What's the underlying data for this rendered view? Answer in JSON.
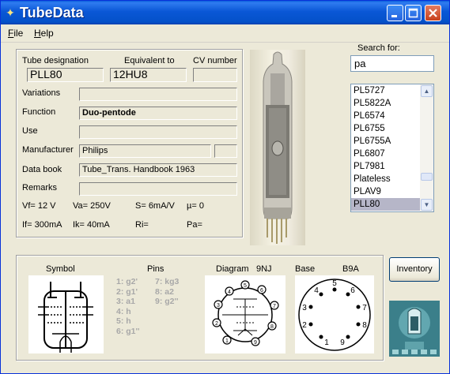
{
  "window": {
    "title": "TubeData",
    "app_icon": "lightbulb-icon"
  },
  "menu": [
    {
      "label": "File",
      "accel": "F",
      "rest": "ile"
    },
    {
      "label": "Help",
      "accel": "H",
      "rest": "elp"
    }
  ],
  "fields": {
    "tube_designation_label": "Tube designation",
    "tube_designation_value": "PLL80",
    "equivalent_label": "Equivalent to",
    "equivalent_value": "12HU8",
    "cv_label": "CV number",
    "cv_value": "",
    "variations_label": "Variations",
    "variations_value": "",
    "function_label": "Function",
    "function_value": "Duo-pentode",
    "use_label": "Use",
    "use_value": "",
    "manufacturer_label": "Manufacturer",
    "manufacturer_value": "Philips",
    "manufacturer_code": "",
    "databook_label": "Data book",
    "databook_value": "Tube_Trans. Handbook 1963",
    "remarks_label": "Remarks",
    "remarks_value": ""
  },
  "params": {
    "vf": "Vf= 12 V",
    "va": "Va= 250V",
    "s": "S= 6mA/V",
    "mu": "µ=   0",
    "if": "If= 300mA",
    "ik": "Ik=  40mA",
    "ri": "Ri=",
    "pa": "Pa="
  },
  "search": {
    "label": "Search for:",
    "value": "pa",
    "results": [
      "PL5727",
      "PL5822A",
      "PL6574",
      "PL6755",
      "PL6755A",
      "PL6807",
      "PL7981",
      "Plateless",
      "PLAV9",
      "PLL80"
    ],
    "selected": "PLL80"
  },
  "bottom": {
    "symbol_label": "Symbol",
    "pins_label": "Pins",
    "pins": [
      "1: g2'",
      "2: g1'",
      "3: a1",
      "4: h",
      "5: h",
      "6: g1''",
      "7: kg3",
      "8: a2",
      "9: g2''"
    ],
    "diagram_label": "Diagram",
    "diagram_code": "9NJ",
    "base_label": "Base",
    "base_code": "B9A",
    "diagram_pin_numbers": [
      "1",
      "2",
      "3",
      "4",
      "5",
      "6",
      "7",
      "8",
      "9"
    ],
    "base_pin_numbers": [
      "1",
      "2",
      "3",
      "4",
      "5",
      "6",
      "7",
      "8",
      "9"
    ]
  },
  "buttons": {
    "inventory": "Inventory"
  },
  "colors": {
    "titlebar": "#0a57d6",
    "window_bg": "#ece9d8",
    "selection": "#b6b6c8"
  }
}
